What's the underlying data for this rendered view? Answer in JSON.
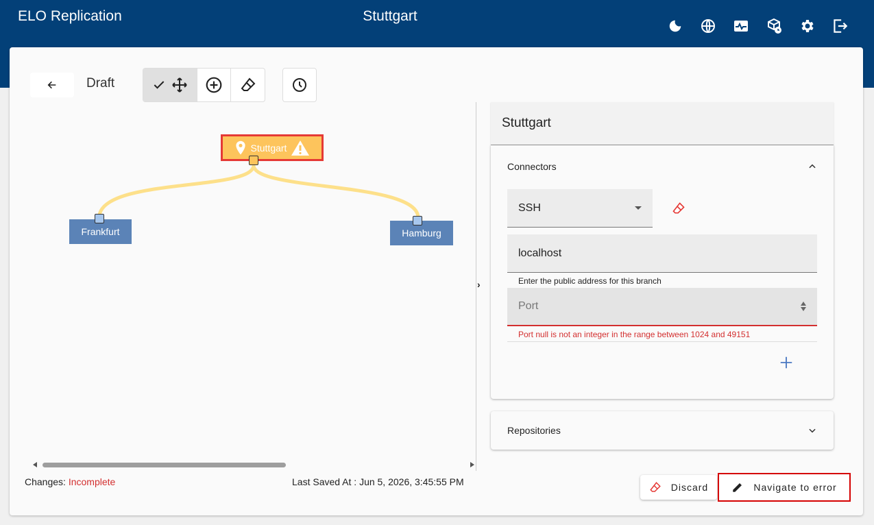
{
  "app": {
    "title": "ELO Replication",
    "location": "Stuttgart"
  },
  "topbar": {
    "icons": [
      "dark-mode-icon",
      "language-icon",
      "monitoring-icon",
      "package-status-icon",
      "settings-icon",
      "logout-icon"
    ]
  },
  "toolbar": {
    "back": "back-arrow-icon",
    "mode": "Draft"
  },
  "graph": {
    "nodes": [
      {
        "label": "Stuttgart",
        "status": "warning"
      },
      {
        "label": "Frankfurt"
      },
      {
        "label": "Hamburg"
      }
    ]
  },
  "status": {
    "changes_label": "Changes:",
    "changes_value": "Incomplete",
    "saved_label": "Last Saved At :",
    "saved_value": "Jun 5, 2026, 3:45:55 PM"
  },
  "panel": {
    "title": "Stuttgart",
    "connectors": {
      "header": "Connectors",
      "type": "SSH",
      "host": "localhost",
      "host_hint": "Enter the public address for this branch",
      "port_placeholder": "Port",
      "port_error": "Port null is not an integer in the range between 1024 and 49151"
    },
    "repositories": {
      "header": "Repositories"
    }
  },
  "actions": {
    "discard": "Discard",
    "navigate": "Navigate to error"
  },
  "colors": {
    "appbar": "#034078",
    "node_warning": "#fdc45c",
    "node_default": "#5b83b7",
    "edge": "#fde08a",
    "error": "#d32f2f"
  }
}
